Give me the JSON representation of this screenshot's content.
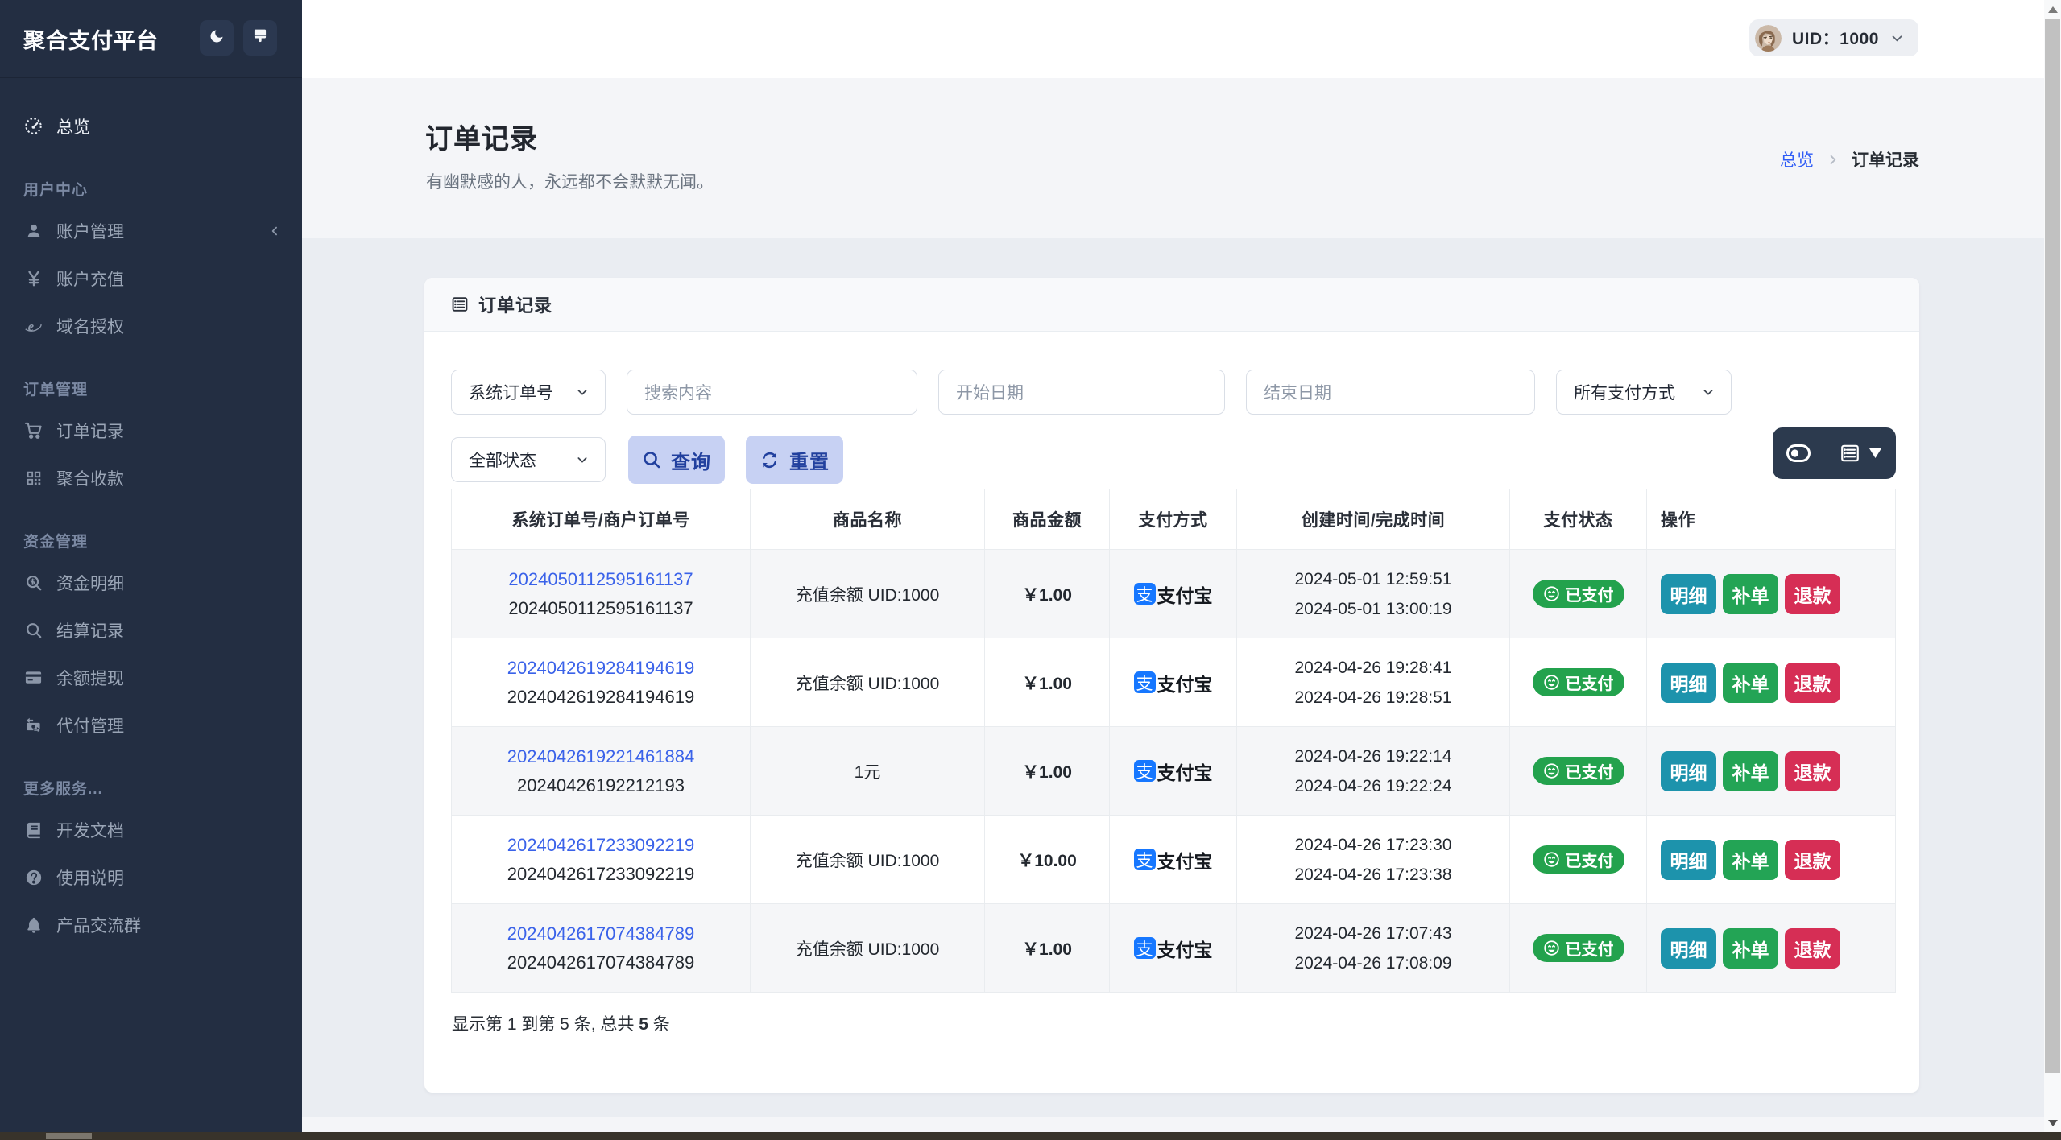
{
  "brand": {
    "title": "聚合支付平台",
    "actions": [
      {
        "icon": "moon-icon"
      },
      {
        "icon": "brush-icon"
      }
    ]
  },
  "sidebar": {
    "sections": [
      {
        "label": "",
        "items": [
          {
            "label": "总览",
            "icon": "dashboard",
            "active": true
          }
        ]
      },
      {
        "label": "用户中心",
        "items": [
          {
            "label": "账户管理",
            "icon": "user",
            "collapsible": true
          },
          {
            "label": "账户充值",
            "icon": "yen"
          },
          {
            "label": "域名授权",
            "icon": "globe"
          }
        ]
      },
      {
        "label": "订单管理",
        "items": [
          {
            "label": "订单记录",
            "icon": "cart"
          },
          {
            "label": "聚合收款",
            "icon": "qrcode"
          }
        ]
      },
      {
        "label": "资金管理",
        "items": [
          {
            "label": "资金明细",
            "icon": "search-dollar"
          },
          {
            "label": "结算记录",
            "icon": "search"
          },
          {
            "label": "余额提现",
            "icon": "credit-card"
          },
          {
            "label": "代付管理",
            "icon": "money-transfer"
          }
        ]
      },
      {
        "label": "更多服务...",
        "items": [
          {
            "label": "开发文档",
            "icon": "book"
          },
          {
            "label": "使用说明",
            "icon": "question-circle"
          },
          {
            "label": "产品交流群",
            "icon": "bell"
          }
        ]
      }
    ]
  },
  "header": {
    "uid": "UID：1000"
  },
  "page": {
    "title": "订单记录",
    "subtitle": "有幽默感的人，永远都不会默默无闻。",
    "breadcrumb": {
      "home": "总览",
      "current": "订单记录"
    }
  },
  "card": {
    "title": "订单记录"
  },
  "filters": {
    "order_type_value": "系统订单号",
    "search_placeholder": "搜索内容",
    "start_date_placeholder": "开始日期",
    "end_date_placeholder": "结束日期",
    "pay_method_value": "所有支付方式",
    "status_value": "全部状态",
    "query_label": "查询",
    "reset_label": "重置"
  },
  "table": {
    "columns": {
      "order_no": "系统订单号/商户订单号",
      "product": "商品名称",
      "amount": "商品金额",
      "pay_method": "支付方式",
      "time": "创建时间/完成时间",
      "status": "支付状态",
      "operation": "操作"
    },
    "pay_method_name": "支付宝",
    "pay_icon_char": "支",
    "paid_label": "已支付",
    "actions": {
      "detail": "明细",
      "redo": "补单",
      "refund": "退款"
    },
    "rows": [
      {
        "order_no": "2024050112595161137",
        "merchant_no": "2024050112595161137",
        "product": "充值余额 UID:1000",
        "amount": "￥1.00",
        "created_at": "2024-05-01 12:59:51",
        "completed_at": "2024-05-01 13:00:19",
        "status": "已支付"
      },
      {
        "order_no": "2024042619284194619",
        "merchant_no": "2024042619284194619",
        "product": "充值余额 UID:1000",
        "amount": "￥1.00",
        "created_at": "2024-04-26 19:28:41",
        "completed_at": "2024-04-26 19:28:51",
        "status": "已支付"
      },
      {
        "order_no": "2024042619221461884",
        "merchant_no": "20240426192212193",
        "product": "1元",
        "amount": "￥1.00",
        "created_at": "2024-04-26 19:22:14",
        "completed_at": "2024-04-26 19:22:24",
        "status": "已支付"
      },
      {
        "order_no": "2024042617233092219",
        "merchant_no": "2024042617233092219",
        "product": "充值余额 UID:1000",
        "amount": "￥10.00",
        "created_at": "2024-04-26 17:23:30",
        "completed_at": "2024-04-26 17:23:38",
        "status": "已支付"
      },
      {
        "order_no": "2024042617074384789",
        "merchant_no": "2024042617074384789",
        "product": "充值余额 UID:1000",
        "amount": "￥1.00",
        "created_at": "2024-04-26 17:07:43",
        "completed_at": "2024-04-26 17:08:09",
        "status": "已支付"
      }
    ],
    "summary_prefix": "显示第 1 到第 5 条, 总共 ",
    "summary_total": "5",
    "summary_suffix": " 条"
  }
}
